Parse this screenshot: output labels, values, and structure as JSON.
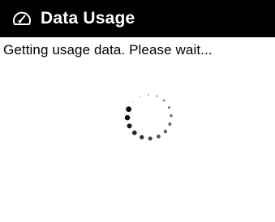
{
  "header": {
    "icon": "speedometer-icon",
    "title": "Data Usage"
  },
  "main": {
    "status_message": "Getting usage data. Please wait...",
    "spinner_icon": "loading-spinner-icon"
  },
  "colors": {
    "header_background": "#000000",
    "header_text": "#ffffff",
    "body_background": "#ffffff",
    "spinner": "#000000"
  }
}
